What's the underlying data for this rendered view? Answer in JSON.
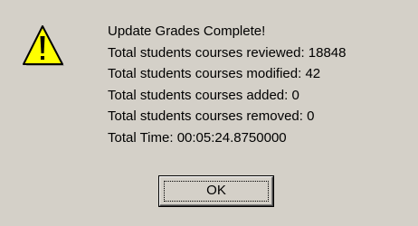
{
  "dialog": {
    "icon": "warning-icon",
    "lines": [
      "Update Grades Complete!",
      "Total students courses reviewed: 18848",
      "Total students courses modified: 42",
      "Total students courses added: 0",
      "Total students courses removed: 0",
      "Total Time: 00:05:24.8750000"
    ],
    "ok_label": "OK"
  },
  "colors": {
    "background": "#d4d0c8",
    "warning_fill": "#ffff00",
    "warning_outline": "#000000",
    "text": "#000000"
  }
}
